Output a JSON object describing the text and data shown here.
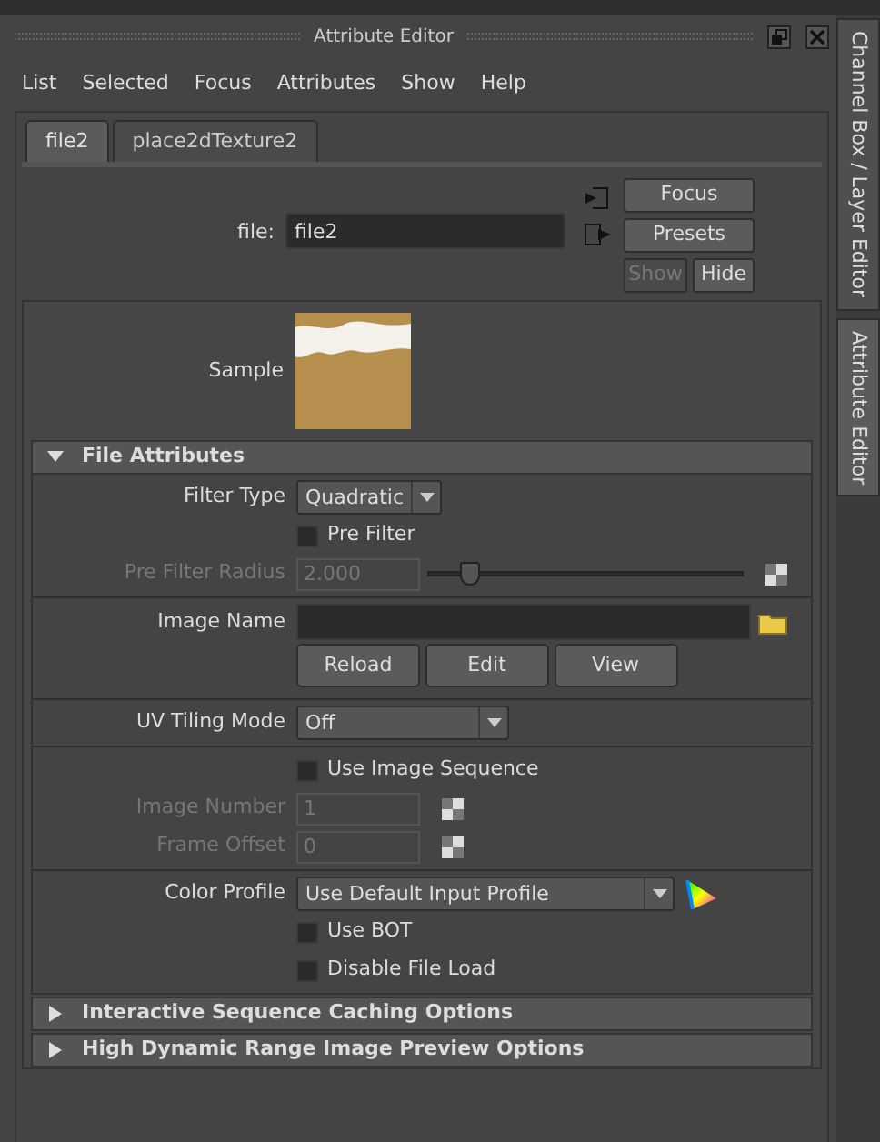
{
  "window": {
    "title": "Attribute Editor"
  },
  "menu": [
    "List",
    "Selected",
    "Focus",
    "Attributes",
    "Show",
    "Help"
  ],
  "tabs": [
    {
      "label": "file2",
      "selected": true
    },
    {
      "label": "place2dTexture2",
      "selected": false
    }
  ],
  "node_field": {
    "label": "file:",
    "value": "file2"
  },
  "header_buttons": [
    {
      "label": "Focus",
      "disabled": false
    },
    {
      "label": "Presets",
      "disabled": false
    },
    {
      "label": "Show",
      "disabled": true
    },
    {
      "label": "Hide",
      "disabled": false
    }
  ],
  "sample": {
    "label": "Sample"
  },
  "sections": [
    {
      "title": "File Attributes",
      "expanded": true,
      "groups": [
        [
          {
            "kind": "dropdown",
            "label": "Filter Type",
            "value": "Quadratic",
            "disabled": false
          },
          {
            "kind": "checkbox",
            "label": "Pre Filter",
            "checked": false
          },
          {
            "kind": "slider",
            "label": "Pre Filter Radius",
            "value": "2.000",
            "level": 0.13,
            "disabled": true
          }
        ],
        [
          {
            "kind": "path",
            "label": "Image Name"
          },
          {
            "kind": "buttons",
            "buttons": [
              "Reload",
              "Edit",
              "View"
            ]
          }
        ],
        [
          {
            "kind": "dropdown",
            "label": "UV Tiling Mode",
            "value": "Off",
            "disabled": false
          }
        ],
        [
          {
            "kind": "checkbox",
            "label": "Use Image Sequence",
            "checked": false
          },
          {
            "kind": "number",
            "label": "Image Number",
            "value": "1",
            "disabled": true
          },
          {
            "kind": "number",
            "label": "Frame Offset",
            "value": "0",
            "disabled": true
          }
        ],
        [
          {
            "kind": "profile",
            "label": "Color Profile",
            "value": "Use Default Input Profile"
          },
          {
            "kind": "checkbox",
            "label": "Use BOT",
            "checked": false
          },
          {
            "kind": "checkbox",
            "label": "Disable File Load",
            "checked": false
          }
        ]
      ]
    },
    {
      "title": "Interactive Sequence Caching Options",
      "expanded": false
    },
    {
      "title": "High Dynamic Range Image Preview Options",
      "expanded": false
    }
  ],
  "side_tabs": [
    {
      "label": "Channel Box / Layer Editor",
      "selected": false
    },
    {
      "label": "Attribute Editor",
      "selected": true
    }
  ]
}
